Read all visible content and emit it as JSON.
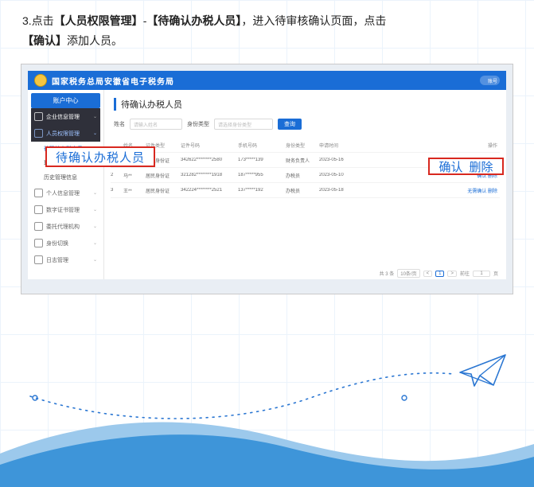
{
  "instruction": {
    "idx": "3.",
    "prefix": "点击",
    "link1": "【人员权限管理】",
    "dash": "-",
    "link2": "【待确认办税人员】",
    "mid": "，进入待审核确认页面，点击",
    "link3": "【确认】",
    "suffix": "添加人员。"
  },
  "app_header": {
    "title": "国家税务总局安徽省电子税务局",
    "account": "账号"
  },
  "sidebar": {
    "primary": "账户中心",
    "dark1": "企业信息管理",
    "active": "人员权限管理",
    "sub_pending": "待确认办税人员",
    "sub_existing": "现有办税人员",
    "sub_history": "历史管理信息",
    "items": [
      "个人信息管理",
      "数字证书管理",
      "委托代理机构",
      "身份切换",
      "日志管理"
    ]
  },
  "main": {
    "title": "待确认办税人员",
    "search": {
      "label1": "姓名",
      "ph1": "请输入姓名",
      "label2": "身份类型",
      "ph2": "请选择身份类型",
      "btn": "查询"
    },
    "headers": [
      "",
      "姓名",
      "证件类型",
      "证件号码",
      "手机号码",
      "身份类型",
      "申请时间",
      "操作"
    ],
    "rows": [
      {
        "idx": "1",
        "name": "王**",
        "doc": "居民身份证",
        "docno": "342622********2580",
        "phone": "173*****139",
        "role": "财务负责人",
        "date": "2023-05-16",
        "op": "无需确认 删除"
      },
      {
        "idx": "2",
        "name": "马**",
        "doc": "居民身份证",
        "docno": "321282********1918",
        "phone": "187*****955",
        "role": "办税员",
        "date": "2023-05-10",
        "op": "确认 删除"
      },
      {
        "idx": "3",
        "name": "王**",
        "doc": "居民身份证",
        "docno": "342224********2521",
        "phone": "137*****192",
        "role": "办税员",
        "date": "2023-05-18",
        "op": "无需确认 删除"
      }
    ],
    "pager": {
      "total": "共 3 条",
      "per": "10条/页",
      "page": "1",
      "goto": "前往",
      "unit": "页"
    }
  },
  "callouts": {
    "left": "待确认办税人员",
    "right1": "确认",
    "right2": "删除"
  }
}
